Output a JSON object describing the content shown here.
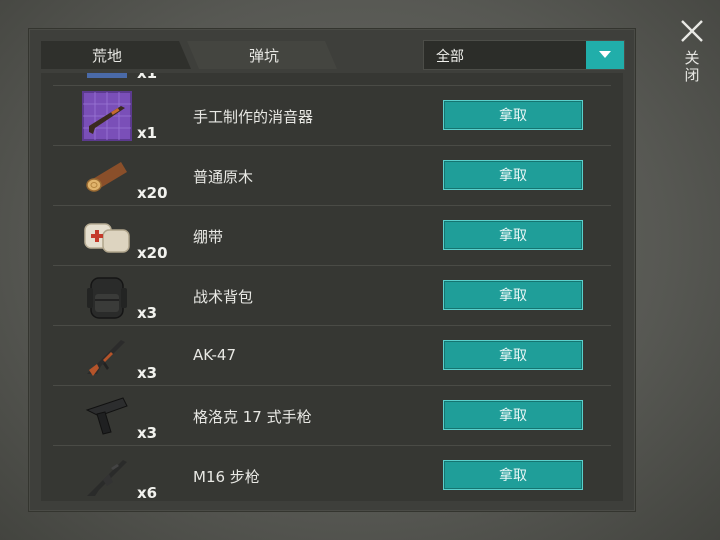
{
  "tabs": [
    {
      "label": "荒地"
    },
    {
      "label": "弹坑"
    }
  ],
  "filter": {
    "selected": "全部"
  },
  "close": {
    "label": "关闭"
  },
  "items": [
    {
      "qty": "x1",
      "name": "",
      "button": ""
    },
    {
      "qty": "x1",
      "name": "手工制作的消音器",
      "button": "拿取",
      "icon": "blueprint-rifle-icon"
    },
    {
      "qty": "x20",
      "name": "普通原木",
      "button": "拿取",
      "icon": "log-icon"
    },
    {
      "qty": "x20",
      "name": "绷带",
      "button": "拿取",
      "icon": "bandage-icon"
    },
    {
      "qty": "x3",
      "name": "战术背包",
      "button": "拿取",
      "icon": "backpack-icon"
    },
    {
      "qty": "x3",
      "name": "AK-47",
      "button": "拿取",
      "icon": "ak47-icon"
    },
    {
      "qty": "x3",
      "name": "格洛克 17 式手枪",
      "button": "拿取",
      "icon": "pistol-icon"
    },
    {
      "qty": "x6",
      "name": "M16 步枪",
      "button": "拿取",
      "icon": "m16-icon"
    }
  ],
  "colors": {
    "accent": "#21aeaa",
    "panel": "#3e3f3b",
    "list": "#363733"
  }
}
